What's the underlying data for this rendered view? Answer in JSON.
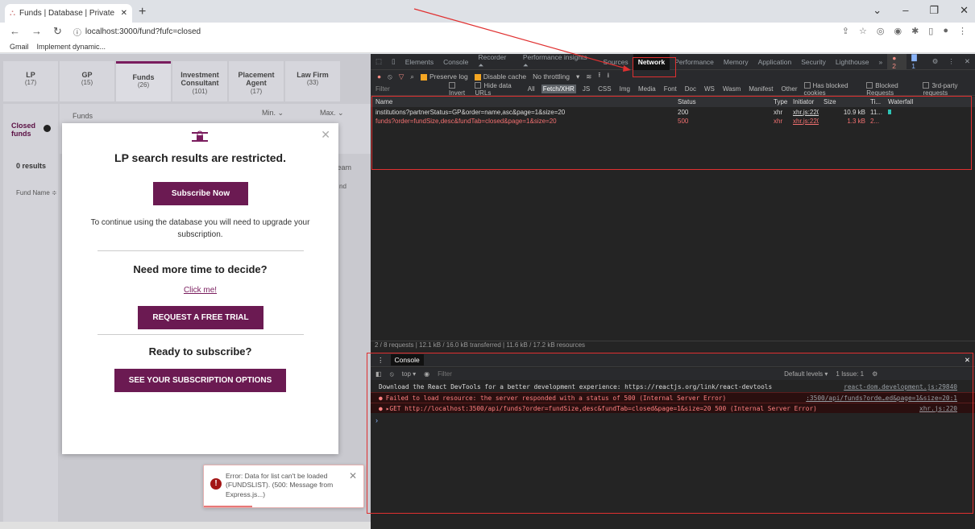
{
  "browser": {
    "tab_title": "Funds | Database | Private Equity",
    "url": "localhost:3000/fund?fufc=closed",
    "bookmarks": [
      "Gmail",
      "Implement dynamic..."
    ],
    "new_tab": "+"
  },
  "page": {
    "tabs": [
      {
        "label": "LP",
        "count": "(17)"
      },
      {
        "label": "GP",
        "count": "(15)"
      },
      {
        "label": "Funds",
        "count": "(26)"
      },
      {
        "label": "Investment Consultant",
        "count": "(101)"
      },
      {
        "label": "Placement Agent",
        "count": "(17)"
      },
      {
        "label": "Law Firm",
        "count": "(33)"
      }
    ],
    "sidebar_closed": "Closed funds",
    "results": "0 results",
    "fund_name_col": "Fund Name ≑",
    "funds_hdr": "Funds",
    "min_hdr": "Min. ⌄",
    "max_hdr": "Max. ⌄",
    "team_hdr": "team",
    "nd_hdr": "nd"
  },
  "modal": {
    "title": "LP search results are restricted.",
    "subscribe": "Subscribe Now",
    "text": "To continue using the database you will need to upgrade your subscription.",
    "need_more": "Need more time to decide?",
    "click": "Click me!",
    "trial": "REQUEST A FREE TRIAL",
    "ready": "Ready to subscribe?",
    "options": "SEE YOUR SUBSCRIPTION OPTIONS"
  },
  "toast": {
    "message": "Error: Data for list can't be loaded (FUNDSLIST). (500: Message from Express.js...)"
  },
  "devtools": {
    "tabs": [
      "Elements",
      "Console",
      "Recorder ⏶",
      "Performance insights ⏶",
      "Sources",
      "Network",
      "Performance",
      "Memory",
      "Application",
      "Security",
      "Lighthouse",
      "»"
    ],
    "errors": "2",
    "issues": "1",
    "toolbar": {
      "preserve": "Preserve log",
      "disable_cache": "Disable cache",
      "throttle": "No throttling"
    },
    "filter": {
      "placeholder": "Filter",
      "invert": "Invert",
      "hide_data": "Hide data URLs",
      "types": [
        "All",
        "Fetch/XHR",
        "JS",
        "CSS",
        "Img",
        "Media",
        "Font",
        "Doc",
        "WS",
        "Wasm",
        "Manifest",
        "Other"
      ],
      "blocked_cookies": "Has blocked cookies",
      "blocked_req": "Blocked Requests",
      "third_party": "3rd-party requests"
    },
    "columns": [
      "Name",
      "Status",
      "Type",
      "Initiator",
      "Size",
      "Ti...",
      "Waterfall"
    ],
    "rows": [
      {
        "name": "institutions?partnerStatus=GP&order=name,asc&page=1&size=20",
        "status": "200",
        "type": "xhr",
        "initiator": "xhr.js:220",
        "size": "10.9 kB",
        "time": "11...",
        "error": false
      },
      {
        "name": "funds?order=fundSize,desc&fundTab=closed&page=1&size=20",
        "status": "500",
        "type": "xhr",
        "initiator": "xhr.js:220",
        "size": "1.3 kB",
        "time": "2...",
        "error": true
      }
    ],
    "summary": "2 / 8 requests  |  12.1 kB / 16.0 kB transferred  |  11.6 kB / 17.2 kB resources",
    "console_tab": "Console",
    "console_toolbar": {
      "context": "top ▾",
      "filter": "Filter",
      "levels": "Default levels ▾",
      "issues": "1 Issue: 1"
    },
    "logs": [
      {
        "msg": "Download the React DevTools for a better development experience: https://reactjs.org/link/react-devtools",
        "src": "react-dom.development.js:29840",
        "error": false
      },
      {
        "msg": "Failed to load resource: the server responded with a status of 500 (Internal Server Error)",
        "src": ":3500/api/funds?orde…ed&page=1&size=20:1",
        "error": true
      },
      {
        "msg": "▸GET http://localhost:3500/api/funds?order=fundSize,desc&fundTab=closed&page=1&size=20 500 (Internal Server Error)",
        "src": "xhr.js:220",
        "error": true
      }
    ]
  }
}
